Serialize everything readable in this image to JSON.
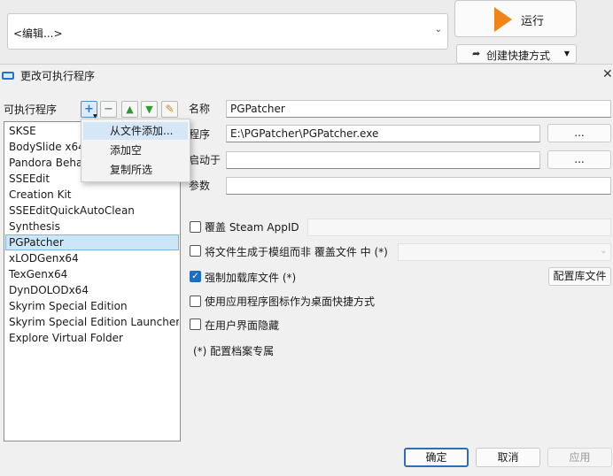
{
  "background": {
    "executable_select_value": "<编辑...>",
    "run_label": "运行",
    "shortcut_label": "创建快捷方式"
  },
  "dialog": {
    "title": "更改可执行程序",
    "executables_label": "可执行程序",
    "list": [
      "SKSE",
      "BodySlide x64",
      "Pandora Beha",
      "SSEEdit",
      "Creation Kit",
      "SSEEditQuickAutoClean",
      "Synthesis",
      "PGPatcher",
      "xLODGenx64",
      "TexGenx64",
      "DynDOLODx64",
      "Skyrim Special Edition",
      "Skyrim Special Edition Launcher",
      "Explore Virtual Folder"
    ],
    "selected_index": 7,
    "context_menu": [
      "从文件添加...",
      "添加空",
      "复制所选"
    ],
    "fields": {
      "title_label": "名称",
      "title_value": "PGPatcher",
      "binary_label": "程序",
      "binary_value": "E:\\PGPatcher\\PGPatcher.exe",
      "start_in_label": "启动于",
      "start_in_value": "",
      "arguments_label": "参数",
      "arguments_value": "",
      "browse_label": "..."
    },
    "options": {
      "steam_appid_label": "覆盖 Steam AppID",
      "steam_appid_checked": false,
      "create_files_label": "将文件生成于模组而非 覆盖文件 中 (*)",
      "create_files_checked": false,
      "force_load_label": "强制加载库文件 (*)",
      "force_load_checked": true,
      "configure_libraries_label": "配置库文件",
      "use_icon_label": "使用应用程序图标作为桌面快捷方式",
      "use_icon_checked": false,
      "hide_label": "在用户界面隐藏",
      "hide_checked": false,
      "note": "(*) 配置档案专属"
    },
    "buttons": {
      "ok": "确定",
      "cancel": "取消",
      "apply": "应用"
    }
  }
}
